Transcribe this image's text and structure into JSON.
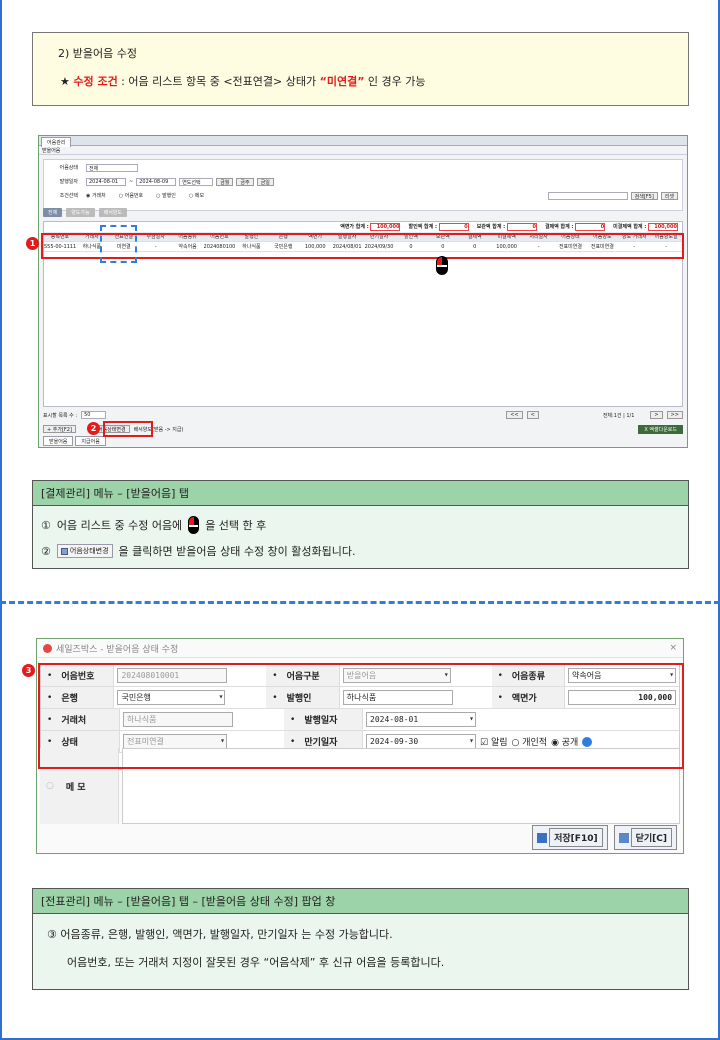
{
  "note": {
    "heading": "2) 받을어음 수정",
    "star": "★",
    "cond_label": "수정 조건",
    "cond_text": " : 어음 리스트 항목  중 <전표연결> 상태가 ",
    "cond_value": "“미연결”",
    "cond_tail": " 인 경우 가능"
  },
  "shot1": {
    "tab": "어음관리",
    "header": "받을어음",
    "filters": {
      "status_label": "어음상태",
      "status_value": "전체",
      "date_label": "발행일자",
      "date_from": "2024-08-01",
      "date_to": "2024-08-09",
      "year_select": "연도선택",
      "btn_this_week": "금월",
      "btn_q": "금주",
      "btn_y": "금일",
      "cond_label": "조건선택",
      "radio1": "거래처",
      "radio2": "어음번호",
      "radio3": "발행인",
      "radio4": "메모",
      "search_btn": "검색[F5]",
      "reset_btn": "리셋"
    },
    "toolbar": {
      "all": "전체",
      "transfer_ok": "양도가능",
      "transferred": "배서양도"
    },
    "totals": [
      {
        "label": "액면가 합계 :",
        "value": "100,000"
      },
      {
        "label": "할인액 합계 :",
        "value": "0"
      },
      {
        "label": "보관액 합계 :",
        "value": "0"
      },
      {
        "label": "결제액 합계 :",
        "value": "0"
      },
      {
        "label": "미결제액 합계 :",
        "value": "100,000"
      }
    ],
    "columns": [
      "등록번호",
      "거래처",
      "전표연결",
      "수금일자",
      "어음종류",
      "어음번호",
      "발행인",
      "은행",
      "액면가",
      "발행일자",
      "만기일자",
      "할인액",
      "보관액",
      "결제액",
      "미결제액",
      "처리일자",
      "어음상태",
      "어음양도",
      "양도 거래처",
      "어음양도일"
    ],
    "row": [
      "555-00-11111",
      "하나식품",
      "미연결",
      "-",
      "약속어음",
      "202408010001",
      "하나식품",
      "국민은행",
      "100,000",
      "2024/08/01",
      "2024/09/30",
      "0",
      "0",
      "0",
      "100,000",
      "-",
      "전표미연결",
      "전표미연결",
      "-",
      "-"
    ],
    "page_size_label": "표시할 목록 수 :",
    "page_size": "50",
    "page_info": "전체:1건 | 1/1",
    "add_btn": "추가[F2]",
    "status_btn": "어음상태변경",
    "transfer_btn": "배서양도(받음 -> 지급)",
    "excel_btn": "엑셀다운로드",
    "tabs": [
      "받을어음",
      "지급어음"
    ]
  },
  "box1": {
    "title": "[결제관리] 메뉴 – [받을어음] 탭",
    "line1_num": "①",
    "line1_a": "어음 리스트 중 수정 어음에",
    "line1_b": "을  선택 한 후",
    "line2_num": "②",
    "line2_chip": "어음상태변경",
    "line2_text": "을 클릭하면 받을어음 상태 수정 창이 활성화됩니다."
  },
  "shot2": {
    "title": "세일즈박스 - 받을어음 상태 수정",
    "close": "×",
    "labels": {
      "no": "어음번호",
      "kind": "어음구분",
      "type": "어음종류",
      "bank": "은행",
      "issuer": "발행인",
      "face": "액면가",
      "client": "거래처",
      "issue_date": "발행일자",
      "status": "상태",
      "due_date": "만기일자",
      "memo": "메 모"
    },
    "values": {
      "no": "202408010001",
      "kind": "받을어음",
      "type": "약속어음",
      "bank": "국민은행",
      "issuer": "하나식품",
      "face": "100,000",
      "client": "하나식품",
      "issue_date": "2024-08-01",
      "status": "전표미연결",
      "due_date": "2024-09-30",
      "alarm": "알림",
      "private": "개인적",
      "public": "공개"
    },
    "save_btn": "저장[F10]",
    "close_btn": "닫기[C]"
  },
  "box2": {
    "title": "[전표관리] 메뉴 – [받을어음] 탭 – [받을어음 상태 수정] 팝업 창",
    "line1": "③  어음종류, 은행, 발행인, 액면가, 발행일자, 만기일자 는 수정 가능합니다.",
    "line2": "어음번호, 또는 거래처 지정이 잘못된 경우 “어음삭제” 후 신규 어음을 등록합니다."
  },
  "badges": [
    "1",
    "2",
    "3"
  ]
}
